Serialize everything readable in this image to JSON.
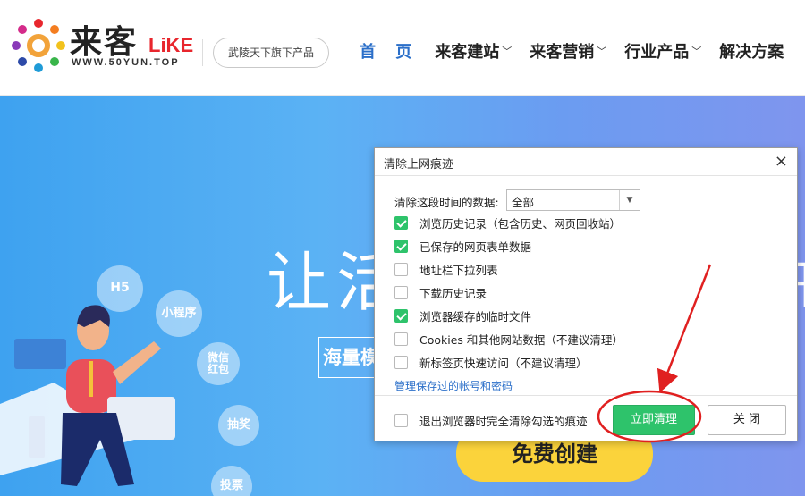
{
  "header": {
    "logo_text": "来客",
    "logo_like": "LiKE",
    "logo_url": "WWW.50YUN.TOP",
    "slogan": "武陵天下旗下产品",
    "nav": [
      {
        "label": "首 页",
        "active": true
      },
      {
        "label": "来客建站",
        "dropdown": true
      },
      {
        "label": "来客营销",
        "dropdown": true
      },
      {
        "label": "行业产品",
        "dropdown": true
      },
      {
        "label": "解决方案"
      }
    ]
  },
  "banner": {
    "title_visible": "让活",
    "title_right_fragment": "冊",
    "subtitle_fragment": "海量模",
    "cta_label": "免费创建",
    "bubbles": [
      "H5",
      "小程序",
      "微信\n红包",
      "抽奖",
      "投票"
    ]
  },
  "dialog": {
    "title": "清除上网痕迹",
    "close_glyph": "×",
    "range_label": "清除这段时间的数据:",
    "range_value": "全部",
    "options": [
      {
        "label": "浏览历史记录（包含历史、网页回收站）",
        "checked": true
      },
      {
        "label": "已保存的网页表单数据",
        "checked": true
      },
      {
        "label": "地址栏下拉列表",
        "checked": false
      },
      {
        "label": "下载历史记录",
        "checked": false
      },
      {
        "label": "浏览器缓存的临时文件",
        "checked": true
      },
      {
        "label": "Cookies 和其他网站数据（不建议清理）",
        "checked": false
      },
      {
        "label": "新标签页快速访问（不建议清理）",
        "checked": false
      }
    ],
    "manage_link": "管理保存过的帐号和密码",
    "footer_option": {
      "label": "退出浏览器时完全清除勾选的痕迹",
      "checked": false
    },
    "clear_button": "立即清理",
    "close_button": "关 闭"
  },
  "colors": {
    "accent_green": "#2ec36b",
    "link_blue": "#2b6fc9",
    "annotation_red": "#e02020",
    "banner_yellow": "#fbd33b"
  }
}
